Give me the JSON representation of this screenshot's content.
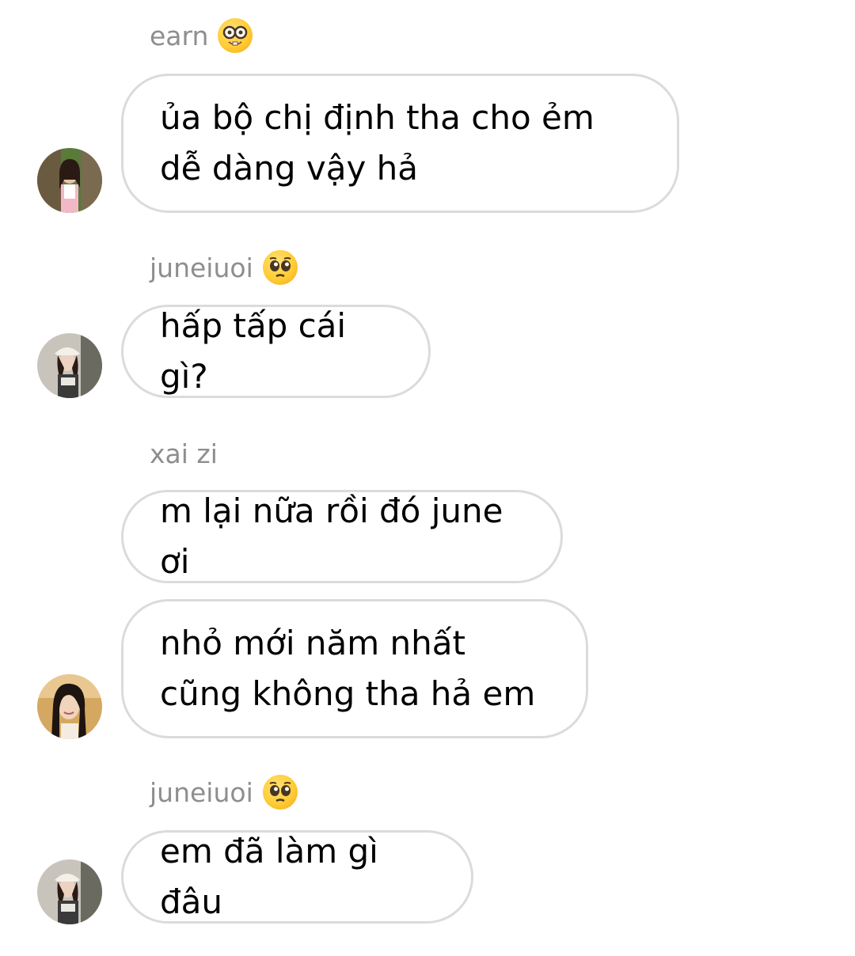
{
  "messages": [
    {
      "sender": "earn",
      "sender_emoji": "nerd-face-emoji",
      "text": "ủa bộ chị định tha cho ẻm dễ dàng vậy hả"
    },
    {
      "sender": "juneiuoi",
      "sender_emoji": "pleading-face-emoji",
      "text": "hấp tấp cái gì?"
    },
    {
      "sender": "xai zi",
      "sender_emoji": "",
      "text": "m lại nữa rồi đó june ơi"
    },
    {
      "sender": "",
      "sender_emoji": "",
      "text": "nhỏ mới năm nhất cũng không tha hả em"
    },
    {
      "sender": "juneiuoi",
      "sender_emoji": "pleading-face-emoji",
      "text": "em đã làm gì đâu"
    }
  ]
}
